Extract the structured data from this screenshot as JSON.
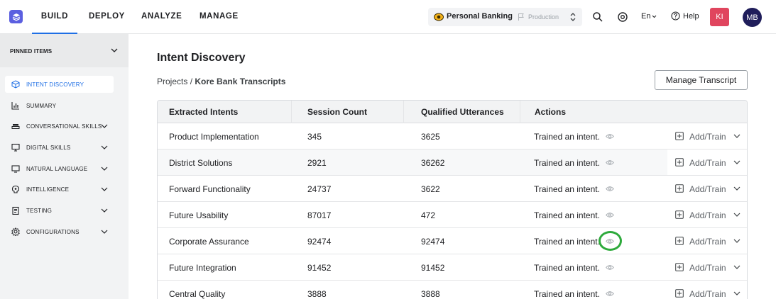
{
  "nav": {
    "tabs": [
      {
        "label": "BUILD",
        "active": true
      },
      {
        "label": "DEPLOY",
        "active": false
      },
      {
        "label": "ANALYZE",
        "active": false
      },
      {
        "label": "MANAGE",
        "active": false
      }
    ],
    "project": "Personal Banking",
    "environment": "Production",
    "language": "En",
    "help": "Help",
    "avatar_initials_1": "KI",
    "avatar_initials_2": "MB",
    "accent_color": "#1f6fe5"
  },
  "sidebar": {
    "pinned_label": "PINNED ITEMS",
    "items": [
      {
        "label": "INTENT DISCOVERY",
        "icon": "cube-icon",
        "active": true,
        "expandable": false
      },
      {
        "label": "SUMMARY",
        "icon": "bar-chart-icon",
        "active": false,
        "expandable": false
      },
      {
        "label": "CONVERSATIONAL SKILLS",
        "icon": "stack-icon",
        "active": false,
        "expandable": true
      },
      {
        "label": "DIGITAL SKILLS",
        "icon": "monitor-icon",
        "active": false,
        "expandable": true
      },
      {
        "label": "NATURAL LANGUAGE",
        "icon": "keyboard-icon",
        "active": false,
        "expandable": true
      },
      {
        "label": "INTELLIGENCE",
        "icon": "brain-icon",
        "active": false,
        "expandable": true
      },
      {
        "label": "TESTING",
        "icon": "clipboard-icon",
        "active": false,
        "expandable": true
      },
      {
        "label": "CONFIGURATIONS",
        "icon": "settings-icon",
        "active": false,
        "expandable": true
      }
    ]
  },
  "main": {
    "title": "Intent Discovery",
    "breadcrumb_root": "Projects",
    "breadcrumb_sep": " / ",
    "breadcrumb_current": "Kore Bank Transcripts",
    "manage_button": "Manage Transcript",
    "columns": [
      "Extracted Intents",
      "Session Count",
      "Qualified Utterances",
      "Actions"
    ],
    "add_label": "Add/Train",
    "rows": [
      {
        "intent": "Product Implementation",
        "sessions": "345",
        "utterances": "3625",
        "action": "Trained an intent."
      },
      {
        "intent": "District Solutions",
        "sessions": "2921",
        "utterances": "36262",
        "action": "Trained an intent."
      },
      {
        "intent": "Forward Functionality",
        "sessions": "24737",
        "utterances": "3622",
        "action": "Trained an intent."
      },
      {
        "intent": "Future Usability",
        "sessions": "87017",
        "utterances": "472",
        "action": "Trained an intent."
      },
      {
        "intent": "Corporate Assurance",
        "sessions": "92474",
        "utterances": "92474",
        "action": "Trained an intent."
      },
      {
        "intent": "Future Integration",
        "sessions": "91452",
        "utterances": "91452",
        "action": "Trained an intent."
      },
      {
        "intent": "Central Quality",
        "sessions": "3888",
        "utterances": "3888",
        "action": "Trained an intent."
      }
    ]
  }
}
